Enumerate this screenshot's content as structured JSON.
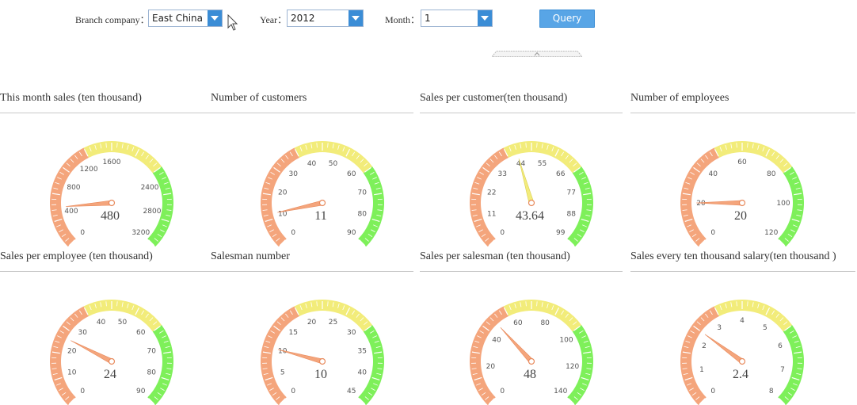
{
  "filters": {
    "branch": {
      "label": "Branch company：",
      "value": "East China"
    },
    "year": {
      "label": "Year：",
      "value": "2012"
    },
    "month": {
      "label": "Month：",
      "value": "1"
    },
    "query_label": "Query"
  },
  "colors": {
    "low": "#f4a57c",
    "mid": "#f2ec7a",
    "high": "#7ef05a",
    "needle": "#f4a57c",
    "needle_yellow": "#f3ec7c"
  },
  "gauges": [
    {
      "title": "This month sales (ten thousand)",
      "value": 480,
      "value_label": "480",
      "min": 0,
      "max": 3200,
      "ticks": [
        "0",
        "400",
        "800",
        "1200",
        "1600",
        "2400",
        "2800",
        "3200"
      ],
      "needle": "orange"
    },
    {
      "title": "Number of customers",
      "value": 11,
      "value_label": "11",
      "min": 0,
      "max": 90,
      "ticks": [
        "0",
        "10",
        "20",
        "30",
        "40",
        "50",
        "60",
        "70",
        "80",
        "90"
      ],
      "needle": "orange"
    },
    {
      "title": "Sales per customer(ten thousand)",
      "value": 43.64,
      "value_label": "43.64",
      "min": 0,
      "max": 99,
      "ticks": [
        "0",
        "11",
        "22",
        "33",
        "44",
        "55",
        "66",
        "77",
        "88",
        "99"
      ],
      "needle": "yellow"
    },
    {
      "title": "Number of employees",
      "value": 20,
      "value_label": "20",
      "min": 0,
      "max": 120,
      "ticks": [
        "0",
        "20",
        "40",
        "60",
        "80",
        "100",
        "120"
      ],
      "needle": "orange"
    },
    {
      "title": "Sales per employee (ten thousand)",
      "value": 24,
      "value_label": "24",
      "min": 0,
      "max": 90,
      "ticks": [
        "0",
        "10",
        "20",
        "30",
        "40",
        "50",
        "60",
        "70",
        "80",
        "90"
      ],
      "needle": "orange"
    },
    {
      "title": "Salesman number",
      "value": 10,
      "value_label": "10",
      "min": 0,
      "max": 45,
      "ticks": [
        "0",
        "5",
        "10",
        "15",
        "20",
        "25",
        "30",
        "35",
        "40",
        "45"
      ],
      "needle": "orange"
    },
    {
      "title": "Sales per salesman (ten thousand)",
      "value": 48,
      "value_label": "48",
      "min": 0,
      "max": 140,
      "ticks": [
        "0",
        "20",
        "40",
        "60",
        "80",
        "100",
        "120",
        "140"
      ],
      "needle": "orange"
    },
    {
      "title": "Sales every ten thousand salary(ten thousand )",
      "value": 2.4,
      "value_label": "2.4",
      "min": 0,
      "max": 8,
      "ticks": [
        "0",
        "1",
        "2",
        "3",
        "4",
        "5",
        "6",
        "7",
        "8"
      ],
      "needle": "orange"
    }
  ]
}
